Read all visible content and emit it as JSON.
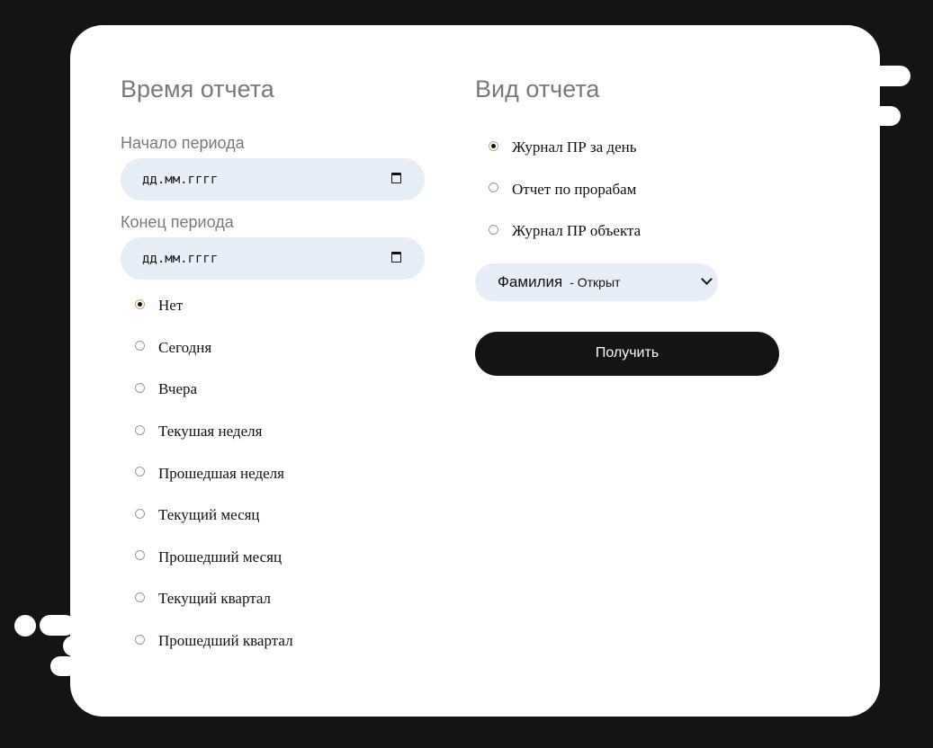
{
  "time_section": {
    "title": "Время отчета",
    "start_label": "Начало периода",
    "start_value": "дд.мм.гггг",
    "end_label": "Конец периода",
    "end_value": "дд.мм.гггг",
    "period_options": [
      {
        "label": "Нет",
        "checked": true
      },
      {
        "label": "Сегодня",
        "checked": false
      },
      {
        "label": "Вчера",
        "checked": false
      },
      {
        "label": "Текушая неделя",
        "checked": false
      },
      {
        "label": "Прошедшая неделя",
        "checked": false
      },
      {
        "label": "Текущий месяц",
        "checked": false
      },
      {
        "label": "Прошедший месяц",
        "checked": false
      },
      {
        "label": "Текущий квартал",
        "checked": false
      },
      {
        "label": "Прошедший квартал",
        "checked": false
      }
    ]
  },
  "type_section": {
    "title": "Вид отчета",
    "report_options": [
      {
        "label": "Журнал ПР за день",
        "checked": true
      },
      {
        "label": "Отчет по прорабам",
        "checked": false
      },
      {
        "label": "Журнал ПР объекта",
        "checked": false
      }
    ],
    "select_main": "Фамилия",
    "select_sub": "- Открыт",
    "submit_label": "Получить"
  },
  "icons": {
    "calendar": "calendar-icon",
    "select": "chevron-down-icon"
  },
  "colors": {
    "background": "#141414",
    "card": "#ffffff",
    "input_bg": "#e8eef8",
    "heading": "#747a7e",
    "button": "#141414"
  }
}
